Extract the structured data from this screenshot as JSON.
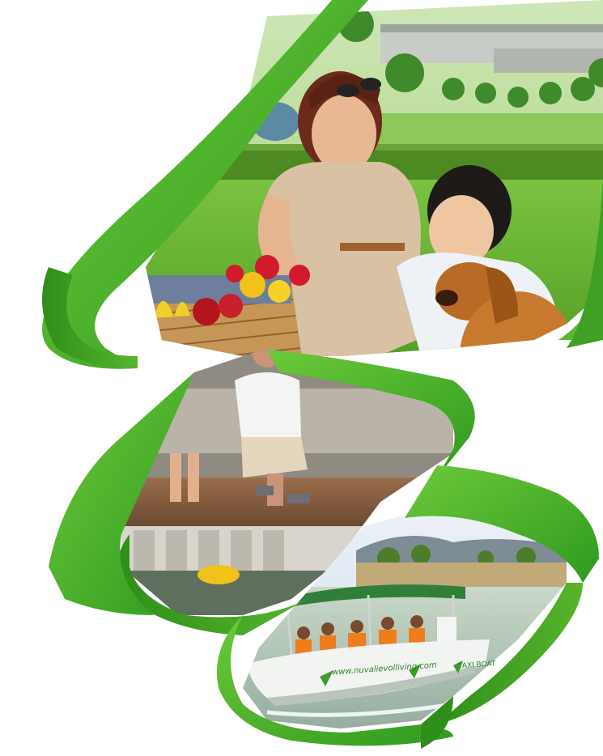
{
  "image": {
    "description_tags": [
      "family-picnic",
      "lakeside-fishing",
      "taxi-boat-tour"
    ],
    "brand_color": "#5ab82e",
    "brand_color_dark": "#2f8f1f"
  },
  "boat": {
    "url_text": "www.nuvalievolliving.com",
    "name_text": "TAXI BOAT"
  }
}
